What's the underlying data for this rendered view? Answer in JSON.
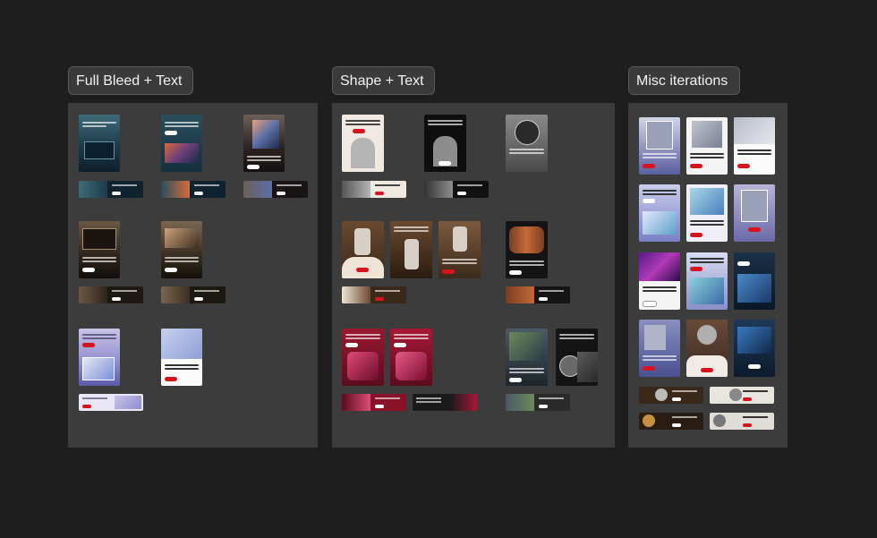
{
  "boards": [
    {
      "label": "Full Bleed + Text"
    },
    {
      "label": "Shape + Text"
    },
    {
      "label": "Misc iterations"
    }
  ],
  "colors": {
    "background": "#1e1e1e",
    "panel": "#3c3c3c",
    "label_bg": "#3a3a3a",
    "accent_red": "#d7141e"
  }
}
